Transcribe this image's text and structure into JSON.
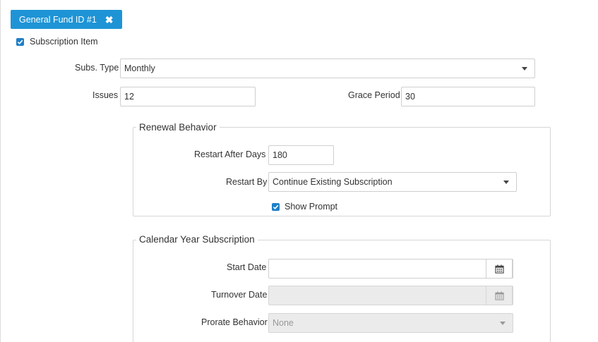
{
  "fund_tag": {
    "label": "General Fund ID #1",
    "close_icon": "close-icon"
  },
  "subscription_item": {
    "label": "Subscription Item",
    "checked": true
  },
  "subs_type": {
    "label": "Subs. Type",
    "value": "Monthly"
  },
  "issues": {
    "label": "Issues",
    "value": "12"
  },
  "grace_period": {
    "label": "Grace Period",
    "value": "30"
  },
  "renewal": {
    "legend": "Renewal Behavior",
    "restart_after_days": {
      "label": "Restart After Days",
      "value": "180"
    },
    "restart_by": {
      "label": "Restart By",
      "value": "Continue Existing Subscription"
    },
    "show_prompt": {
      "label": "Show Prompt",
      "checked": true
    }
  },
  "calendar": {
    "legend": "Calendar Year Subscription",
    "start_date": {
      "label": "Start Date",
      "value": ""
    },
    "turnover_date": {
      "label": "Turnover Date",
      "value": ""
    },
    "prorate_behavior": {
      "label": "Prorate Behavior",
      "value": "None"
    }
  },
  "colors": {
    "accent": "#1e94d6",
    "checkbox": "#1e7fc9"
  }
}
